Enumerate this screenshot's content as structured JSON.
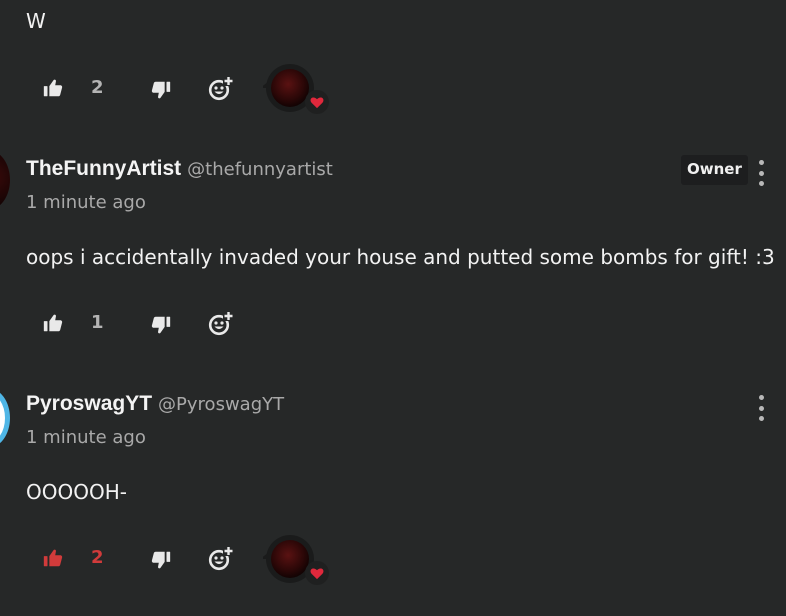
{
  "comments": [
    {
      "text": "W",
      "likes": "2",
      "liked": false,
      "creator_heart": true
    },
    {
      "name": "TheFunnyArtist",
      "handle": "@thefunnyartist",
      "badge": "Owner",
      "time": "1 minute ago",
      "text": "oops i accidentally invaded your house and putted some bombs for gift! :3",
      "likes": "1",
      "liked": false,
      "creator_heart": false
    },
    {
      "name": "PyroswagYT",
      "handle": "@PyroswagYT",
      "time": "1 minute ago",
      "text": "OOOOOH-",
      "likes": "2",
      "liked": true,
      "creator_heart": true
    }
  ],
  "colors": {
    "background": "#262828",
    "liked_red": "#d13b3b",
    "heart_red": "#e0283c"
  },
  "icons": [
    "thumbs-up-icon",
    "thumbs-down-icon",
    "add-reaction-icon",
    "heart-icon",
    "more-vertical-icon"
  ]
}
